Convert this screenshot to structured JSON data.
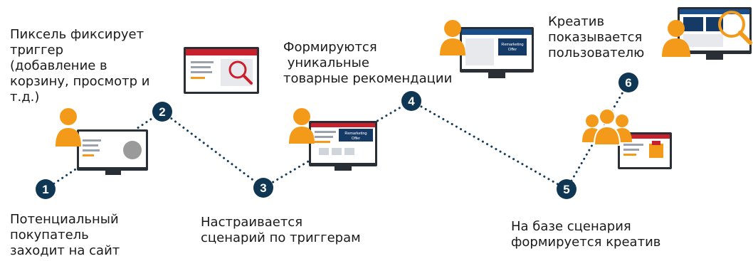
{
  "colors": {
    "node": "#0f3652",
    "dots": "#123a5a",
    "person": "#f39a1a",
    "monitor": "#2a2f36",
    "accent_red": "#c8202d",
    "header_blue": "#1a4f8c",
    "dark_blue_block": "#163a66"
  },
  "steps": [
    {
      "number": "1",
      "lines": [
        "Потенциальный",
        "покупатель",
        "заходит на сайт"
      ],
      "icon": "person-at-monitor-icon"
    },
    {
      "number": "2",
      "lines": [
        "Пиксель фиксирует",
        "триггер",
        "(добавление в",
        "корзину, просмотр и",
        "т.д.)"
      ],
      "icon": "web-page-magnifier-icon"
    },
    {
      "number": "3",
      "lines": [
        "Настраивается",
        "сценарий по триггерам"
      ],
      "icon": "person-at-monitor-icon"
    },
    {
      "number": "4",
      "lines": [
        "Формируются",
        " уникальные",
        "товарные рекомендации"
      ],
      "icon": "person-at-monitor-icon"
    },
    {
      "number": "5",
      "lines": [
        "На базе сценария",
        "формируется креатив"
      ],
      "icon": "audience-group-icon"
    },
    {
      "number": "6",
      "lines": [
        "Креатив",
        "показывается",
        "пользователю"
      ],
      "icon": "person-at-monitor-magnifier-icon"
    }
  ],
  "screen_text": {
    "remarketing_offer": [
      "Remarketing",
      "Offer"
    ]
  }
}
